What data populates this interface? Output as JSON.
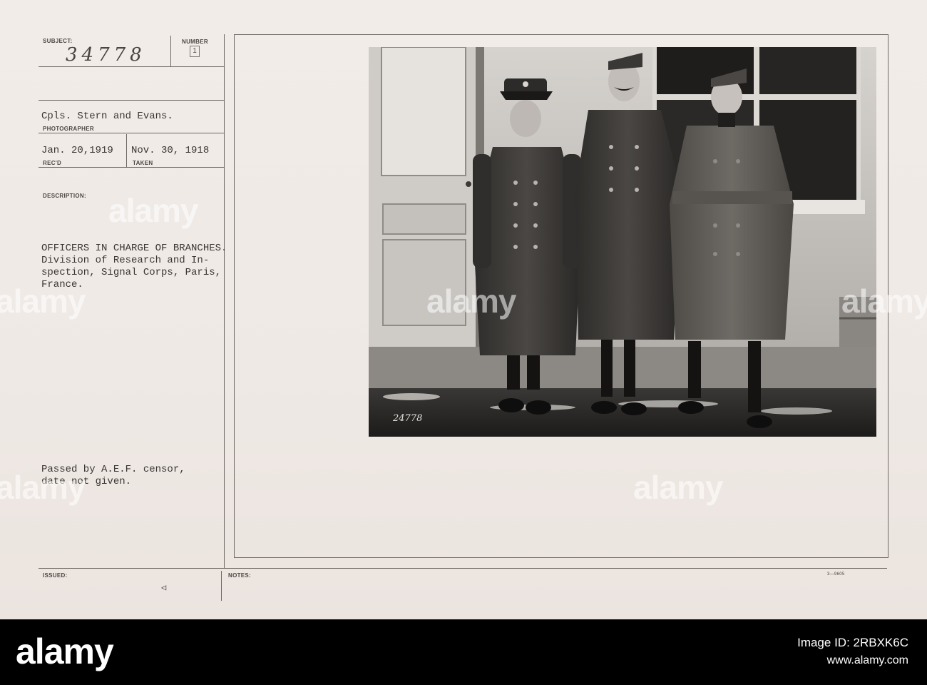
{
  "card": {
    "subject_label": "SUBJECT:",
    "subject_number": "34778",
    "number_label": "NUMBER",
    "number_stamp": "1",
    "photographer_value": "Cpls. Stern and Evans.",
    "photographer_label": "PHOTOGRAPHER",
    "received_value": "Jan. 20,1919",
    "received_label": "REC'D",
    "taken_value": "Nov. 30, 1918",
    "taken_label": "TAKEN",
    "description_label": "DESCRIPTION:",
    "description_lines": [
      "OFFICERS IN CHARGE OF BRANCHES.",
      "Division of Research and In-",
      "spection, Signal Corps, Paris,",
      "France."
    ],
    "censor_lines": [
      "Passed by A.E.F. censor,",
      "date not given."
    ],
    "issued_label": "ISSUED:",
    "issued_mark": "◁",
    "notes_label": "NOTES:",
    "form_code": "3—9605",
    "photo_negative_number": "24778"
  },
  "watermark": {
    "text": "alamy"
  },
  "stock_bar": {
    "brand": "alamy",
    "image_id_label": "Image ID: 2RBXK6C",
    "url": "www.alamy.com"
  }
}
